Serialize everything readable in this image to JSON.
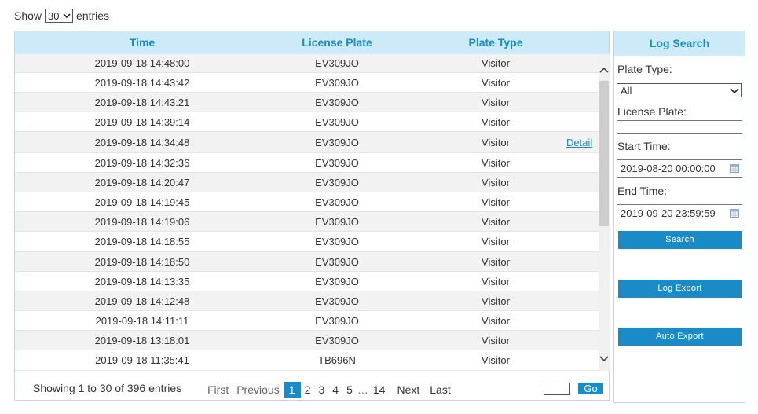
{
  "show": {
    "prefix": "Show",
    "value": "30",
    "suffix": "entries"
  },
  "table": {
    "headers": {
      "time": "Time",
      "plate": "License Plate",
      "type": "Plate Type"
    },
    "detail_label": "Detail",
    "rows": [
      {
        "time": "2019-09-18 14:48:00",
        "plate": "EV309JO",
        "type": "Visitor"
      },
      {
        "time": "2019-09-18 14:43:42",
        "plate": "EV309JO",
        "type": "Visitor"
      },
      {
        "time": "2019-09-18 14:43:21",
        "plate": "EV309JO",
        "type": "Visitor"
      },
      {
        "time": "2019-09-18 14:39:14",
        "plate": "EV309JO",
        "type": "Visitor"
      },
      {
        "time": "2019-09-18 14:34:48",
        "plate": "EV309JO",
        "type": "Visitor"
      },
      {
        "time": "2019-09-18 14:32:36",
        "plate": "EV309JO",
        "type": "Visitor"
      },
      {
        "time": "2019-09-18 14:20:47",
        "plate": "EV309JO",
        "type": "Visitor"
      },
      {
        "time": "2019-09-18 14:19:45",
        "plate": "EV309JO",
        "type": "Visitor"
      },
      {
        "time": "2019-09-18 14:19:06",
        "plate": "EV309JO",
        "type": "Visitor"
      },
      {
        "time": "2019-09-18 14:18:55",
        "plate": "EV309JO",
        "type": "Visitor"
      },
      {
        "time": "2019-09-18 14:18:50",
        "plate": "EV309JO",
        "type": "Visitor"
      },
      {
        "time": "2019-09-18 14:13:35",
        "plate": "EV309JO",
        "type": "Visitor"
      },
      {
        "time": "2019-09-18 14:12:48",
        "plate": "EV309JO",
        "type": "Visitor"
      },
      {
        "time": "2019-09-18 14:11:11",
        "plate": "EV309JO",
        "type": "Visitor"
      },
      {
        "time": "2019-09-18 13:18:01",
        "plate": "EV309JO",
        "type": "Visitor"
      },
      {
        "time": "2019-09-18 11:35:41",
        "plate": "TB696N",
        "type": "Visitor"
      }
    ]
  },
  "footer": {
    "showing": "Showing 1 to 30 of 396 entries",
    "first": "First",
    "previous": "Previous",
    "pages": [
      "1",
      "2",
      "3",
      "4",
      "5"
    ],
    "ellipsis": "…",
    "last_page": "14",
    "next": "Next",
    "last": "Last",
    "go": "Go"
  },
  "search": {
    "title": "Log Search",
    "plate_type_label": "Plate Type:",
    "plate_type_value": "All",
    "license_plate_label": "License Plate:",
    "start_time_label": "Start Time:",
    "start_time_value": "2019-08-20 00:00:00",
    "end_time_label": "End Time:",
    "end_time_value": "2019-09-20 23:59:59",
    "search_button": "Search",
    "log_export_button": "Log Export",
    "auto_export_button": "Auto Export"
  },
  "colors": {
    "accent": "#1a8bc7",
    "header_bg": "#cdeaf8"
  }
}
